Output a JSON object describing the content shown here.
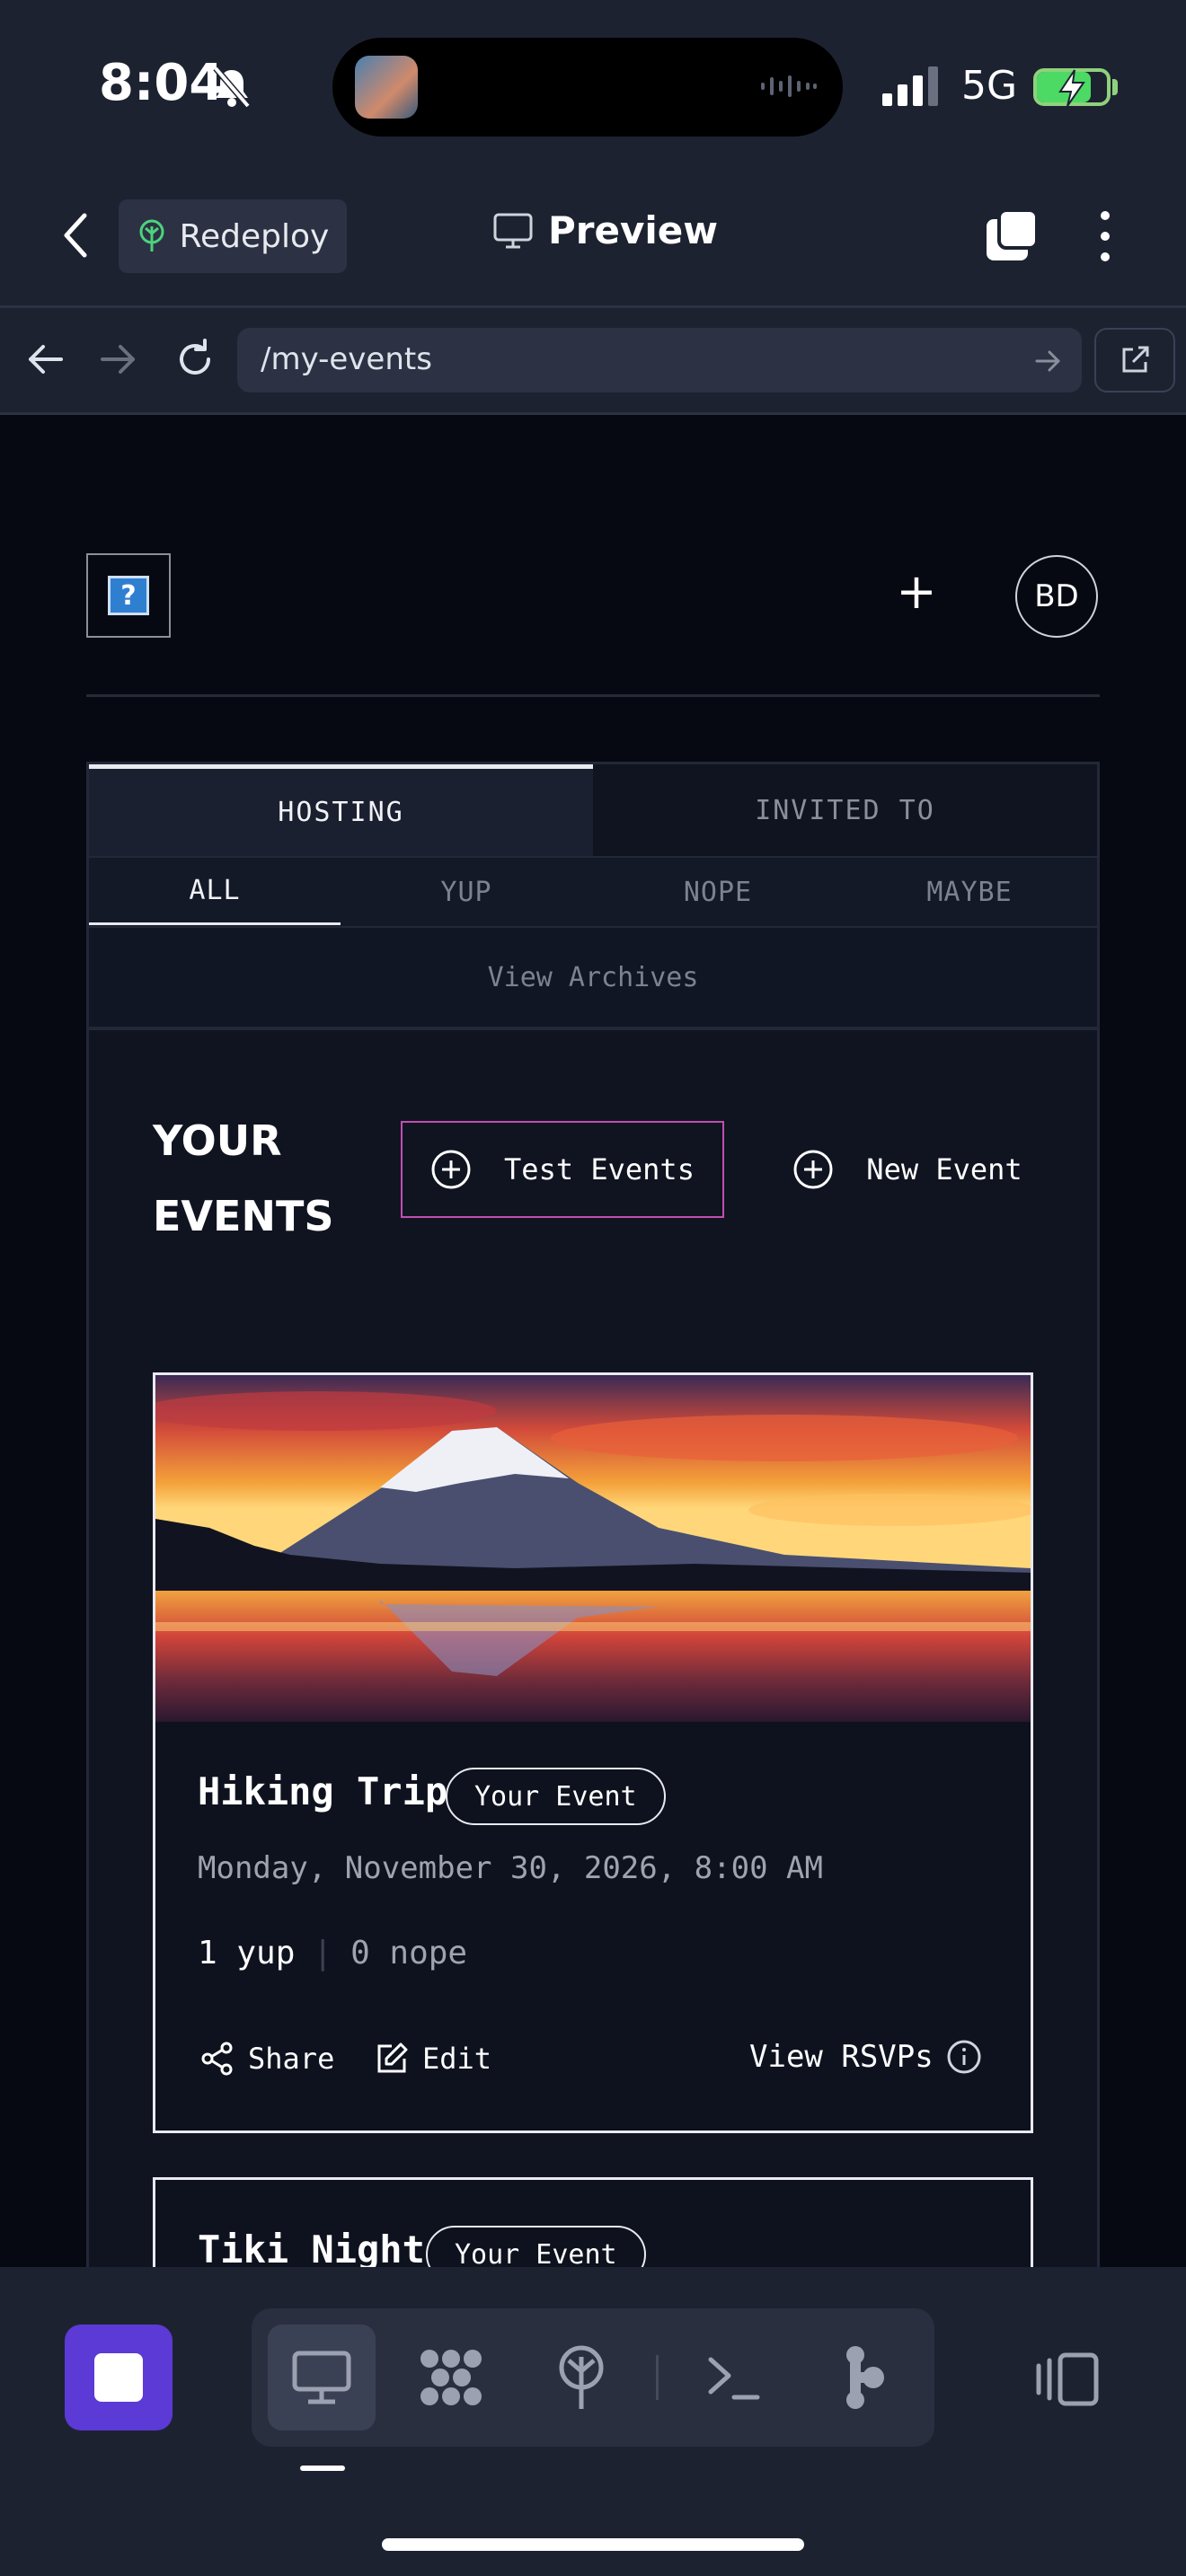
{
  "status_bar": {
    "time": "8:04",
    "network": "5G"
  },
  "app_bar": {
    "redeploy_label": "Redeploy",
    "preview_label": "Preview"
  },
  "url_bar": {
    "url": "/my-events"
  },
  "tabs": {
    "hosting": "HOSTING",
    "invited": "INVITED TO"
  },
  "subtabs": {
    "all": "ALL",
    "yup": "YUP",
    "nope": "NOPE",
    "maybe": "MAYBE"
  },
  "archives_label": "View Archives",
  "header": {
    "add_label": "+",
    "avatar_initials": "BD"
  },
  "events_section": {
    "heading_line1": "YOUR",
    "heading_line2": "EVENTS",
    "test_events_label": "Test Events",
    "new_event_label": "New Event"
  },
  "events": [
    {
      "title": "Hiking Trip",
      "badge": "Your Event",
      "date": "Monday, November 30, 2026, 8:00 AM",
      "yup": "1 yup",
      "separator": "|",
      "nope": "0 nope",
      "share_label": "Share",
      "edit_label": "Edit",
      "rsvps_label": "View RSVPs"
    },
    {
      "title": "Tiki Night",
      "badge": "Your Event"
    }
  ],
  "colors": {
    "background": "#070912",
    "toolbar": "#1d2231",
    "accent_purple": "#5b3ad6",
    "test_events_border": "#c04fb0"
  },
  "icons": [
    "bell-slash-icon",
    "signal-icon",
    "battery-charging-icon",
    "back-chevron-icon",
    "tree-icon",
    "monitor-icon",
    "tabs-icon",
    "more-vertical-icon",
    "arrow-left-icon",
    "arrow-right-icon",
    "reload-icon",
    "open-external-icon",
    "plus-circle-icon",
    "share-icon",
    "edit-icon",
    "info-icon",
    "stop-icon",
    "desktop-icon",
    "grid-icon",
    "deploy-icon",
    "terminal-icon",
    "share-nodes-icon",
    "layout-icon"
  ]
}
